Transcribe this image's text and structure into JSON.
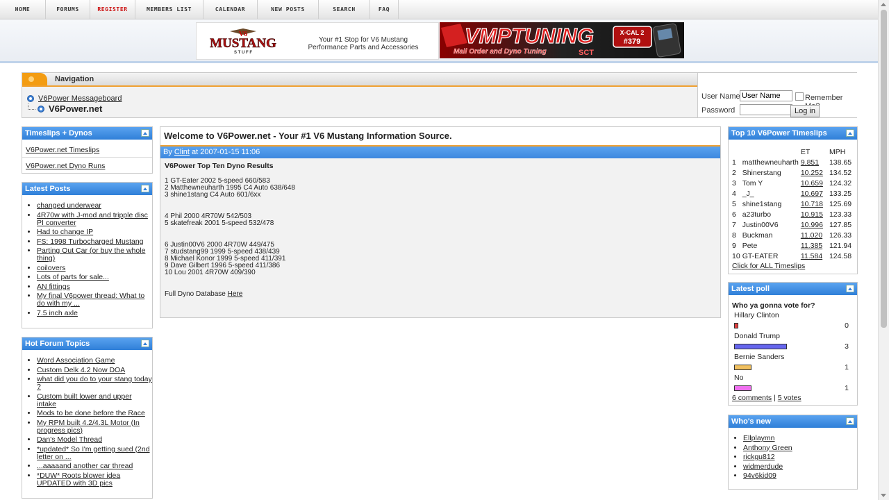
{
  "topnav": [
    {
      "label": "Home",
      "w": 66
    },
    {
      "label": "Forums",
      "w": 64
    },
    {
      "label": "Register",
      "w": 65,
      "highlight": true
    },
    {
      "label": "Members List",
      "w": 98
    },
    {
      "label": "Calendar",
      "w": 78
    },
    {
      "label": "New Posts",
      "w": 88
    },
    {
      "label": "Search",
      "w": 74
    },
    {
      "label": "FAQ",
      "w": 41
    }
  ],
  "ads": {
    "ad1_logo": "MUSTANG",
    "ad1_logo_sub": "S T U F F",
    "ad1_text_line1": "Your #1 Stop for V6 Mustang",
    "ad1_text_line2": "Performance Parts and Accessories",
    "ad2_title": "VMPTUNING",
    "ad2_sub": "Mail Order and Dyno Tuning",
    "ad2_badge": "X-CAL 2 #379",
    "ad2_brand": "SCT"
  },
  "navbar": {
    "title": "Navigation",
    "breadcrumb_parent": "V6Power Messageboard",
    "breadcrumb_current": "V6Power.net"
  },
  "login": {
    "username_label": "User Name",
    "username_value": "User Name",
    "remember_label": "Remember Me?",
    "password_label": "Password",
    "button": "Log in"
  },
  "timeslips_block": {
    "title": "Timeslips + Dynos",
    "links": [
      "V6Power.net Timeslips",
      "V6Power.net Dyno Runs"
    ]
  },
  "latest_posts": {
    "title": "Latest Posts",
    "items": [
      "changed underwear",
      "4R70w with J-mod and tripple disc PI converter",
      "Had to change IP",
      "FS: 1998 Turbocharged Mustang",
      "Parting Out Car (or buy the whole thing)",
      "coilovers",
      "Lots of parts for sale...",
      "AN fittings",
      "My final V6power thread: What to do with my ...",
      "7.5 inch axle"
    ]
  },
  "hot_topics": {
    "title": "Hot Forum Topics",
    "items": [
      "Word Association Game",
      "Custom Delk 4.2 Now DOA",
      "what did you do to your stang today ?",
      "Custom built lower and upper intake",
      "Mods to be done before the Race",
      "My RPM built 4.2/4.3L Motor (In progress pics)",
      "Dan's Model Thread",
      "*updated* So I'm getting sued (2nd letter on ...",
      "...aaaaand another car thread",
      "*DUW* Roots blower idea UPDATED with 3D pics"
    ]
  },
  "post": {
    "title": "Welcome to V6Power.net - Your #1 V6 Mustang Information Source.",
    "by_prefix": "By",
    "author": "Clint",
    "date": "at 2007-01-15 11:06",
    "heading": "V6Power Top Ten Dyno Results",
    "group1": [
      "1 GT-Eater 2002 5-speed 660/583",
      "2 Matthewneuharth 1995 C4 Auto 638/648",
      "3 shine1stang C4 Auto 601/6xx"
    ],
    "group2": [
      "4 Phil 2000 4R70W 542/503",
      "5 skatefreak 2001 5-speed 532/478"
    ],
    "group3": [
      "6 Justin00V6 2000 4R70W 449/475",
      "7 studstang99 1999 5-speed 438/439",
      "8 Michael Konor 1999 5-speed 411/391",
      "9 Dave Gilbert 1996 5-speed 411/386",
      "10 Lou 2001 4R70W 409/390"
    ],
    "footer_prefix": "Full Dyno Database",
    "footer_link": "Here"
  },
  "top10": {
    "title": "Top 10 V6Power Timeslips",
    "col_et": "ET",
    "col_mph": "MPH",
    "rows": [
      [
        "1",
        "matthewneuharth",
        "9.851",
        "138.65"
      ],
      [
        "2",
        "Shinerstang",
        "10.252",
        "134.52"
      ],
      [
        "3",
        "Tom Y",
        "10.659",
        "124.32"
      ],
      [
        "4",
        "_J_",
        "10.697",
        "133.25"
      ],
      [
        "5",
        "shine1stang",
        "10.718",
        "125.69"
      ],
      [
        "6",
        "a23turbo",
        "10.915",
        "123.33"
      ],
      [
        "7",
        "Justin00V6",
        "10.996",
        "127.85"
      ],
      [
        "8",
        "Buckman",
        "11.020",
        "126.33"
      ],
      [
        "9",
        "Pete",
        "11.385",
        "121.94"
      ],
      [
        "10",
        "GT-EATER",
        "11.584",
        "124.58"
      ]
    ],
    "all_link": "Click for ALL Timeslips"
  },
  "poll": {
    "title": "Latest poll",
    "question": "Who ya gonna vote for?",
    "options": [
      {
        "label": "Hillary Clinton",
        "votes": "0",
        "fraction": 0.0,
        "color": "#e04040"
      },
      {
        "label": "Donald Trump",
        "votes": "3",
        "fraction": 0.6,
        "color": "#6666ee"
      },
      {
        "label": "Bernie Sanders",
        "votes": "1",
        "fraction": 0.2,
        "color": "#f0c060"
      },
      {
        "label": "No",
        "votes": "1",
        "fraction": 0.2,
        "color": "#f070f0"
      }
    ],
    "comments": "6 comments",
    "sep": "|",
    "votes": "5 votes"
  },
  "whos_new": {
    "title": "Who's new",
    "items": [
      "Ellplaymn",
      "Anthony Green",
      "rickgu812",
      "widmerdude",
      "94v6kid09"
    ]
  }
}
